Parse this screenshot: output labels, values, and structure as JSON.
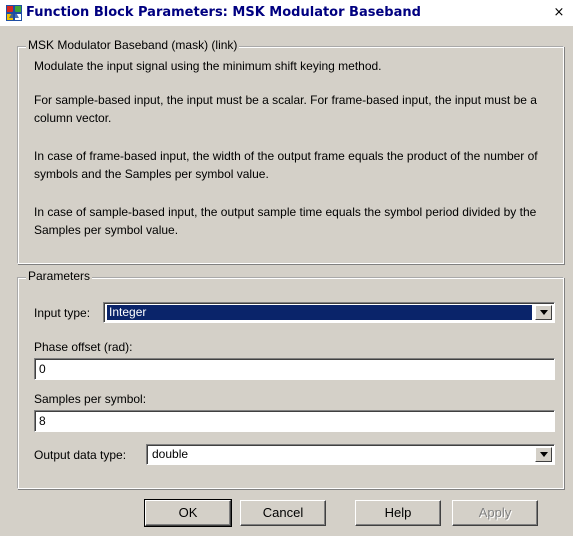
{
  "window": {
    "title": "Function Block Parameters: MSK Modulator Baseband",
    "close_glyph": "×",
    "icon": "simulink-block-icon"
  },
  "description": {
    "group_title": "MSK Modulator Baseband (mask) (link)",
    "paragraphs": [
      "Modulate the input signal using the minimum shift keying method.",
      "For sample-based input, the input must be a scalar. For frame-based input, the input must be a column vector.",
      "In case of frame-based input, the width of the output frame equals the product of the number of symbols and the Samples per symbol value.",
      "In case of sample-based input, the output sample time equals the symbol period divided by the Samples per symbol value."
    ]
  },
  "parameters": {
    "group_title": "Parameters",
    "input_type": {
      "label": "Input type:",
      "value": "Integer"
    },
    "phase_offset": {
      "label": "Phase offset (rad):",
      "value": "0"
    },
    "samples_per_symbol": {
      "label": "Samples per symbol:",
      "value": "8"
    },
    "output_data_type": {
      "label": "Output data type:",
      "value": "double"
    }
  },
  "buttons": {
    "ok": "OK",
    "cancel": "Cancel",
    "help": "Help",
    "apply": "Apply"
  },
  "colors": {
    "title_text": "#000080",
    "dialog_bg": "#d4d0c8",
    "selection": "#0a246a"
  }
}
